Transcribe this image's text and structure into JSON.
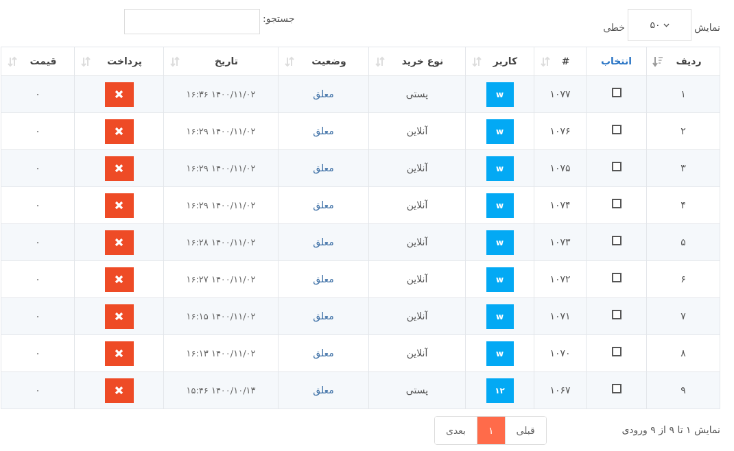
{
  "length_control": {
    "prefix": "نمایش",
    "value": "۵۰",
    "suffix": "خطی"
  },
  "search": {
    "label": "جستجو:"
  },
  "table": {
    "columns": [
      {
        "label": "ردیف",
        "sortable": true,
        "sorted": true,
        "link": false
      },
      {
        "label": "انتخاب",
        "sortable": false,
        "link": true
      },
      {
        "label": "#",
        "sortable": true,
        "sorted": false,
        "link": false
      },
      {
        "label": "کاربر",
        "sortable": true,
        "sorted": false,
        "link": false
      },
      {
        "label": "نوع خرید",
        "sortable": true,
        "sorted": false,
        "link": false
      },
      {
        "label": "وضعیت",
        "sortable": true,
        "sorted": false,
        "link": false
      },
      {
        "label": "تاریخ",
        "sortable": true,
        "sorted": false,
        "link": false
      },
      {
        "label": "پرداخت",
        "sortable": true,
        "sorted": false,
        "link": false
      },
      {
        "label": "قیمت",
        "sortable": true,
        "sorted": false,
        "link": false
      }
    ],
    "rows": [
      {
        "row": "۱",
        "checked": false,
        "id": "۱۰۷۷",
        "user": "w",
        "type": "پستی",
        "status": "معلق",
        "date": "۱۴۰۰/۱۱/۰۲ ۱۶:۳۶",
        "paid": false,
        "price": "۰"
      },
      {
        "row": "۲",
        "checked": false,
        "id": "۱۰۷۶",
        "user": "w",
        "type": "آنلاین",
        "status": "معلق",
        "date": "۱۴۰۰/۱۱/۰۲ ۱۶:۲۹",
        "paid": false,
        "price": "۰"
      },
      {
        "row": "۳",
        "checked": false,
        "id": "۱۰۷۵",
        "user": "w",
        "type": "آنلاین",
        "status": "معلق",
        "date": "۱۴۰۰/۱۱/۰۲ ۱۶:۲۹",
        "paid": false,
        "price": "۰"
      },
      {
        "row": "۴",
        "checked": false,
        "id": "۱۰۷۴",
        "user": "w",
        "type": "آنلاین",
        "status": "معلق",
        "date": "۱۴۰۰/۱۱/۰۲ ۱۶:۲۹",
        "paid": false,
        "price": "۰"
      },
      {
        "row": "۵",
        "checked": false,
        "id": "۱۰۷۳",
        "user": "w",
        "type": "آنلاین",
        "status": "معلق",
        "date": "۱۴۰۰/۱۱/۰۲ ۱۶:۲۸",
        "paid": false,
        "price": "۰"
      },
      {
        "row": "۶",
        "checked": false,
        "id": "۱۰۷۲",
        "user": "w",
        "type": "آنلاین",
        "status": "معلق",
        "date": "۱۴۰۰/۱۱/۰۲ ۱۶:۲۷",
        "paid": false,
        "price": "۰"
      },
      {
        "row": "۷",
        "checked": false,
        "id": "۱۰۷۱",
        "user": "w",
        "type": "آنلاین",
        "status": "معلق",
        "date": "۱۴۰۰/۱۱/۰۲ ۱۶:۱۵",
        "paid": false,
        "price": "۰"
      },
      {
        "row": "۸",
        "checked": false,
        "id": "۱۰۷۰",
        "user": "w",
        "type": "آنلاین",
        "status": "معلق",
        "date": "۱۴۰۰/۱۱/۰۲ ۱۶:۱۳",
        "paid": false,
        "price": "۰"
      },
      {
        "row": "۹",
        "checked": false,
        "id": "۱۰۶۷",
        "user": "۱۲",
        "type": "پستی",
        "status": "معلق",
        "date": "۱۴۰۰/۱۰/۱۳ ۱۵:۴۶",
        "paid": false,
        "price": "۰"
      }
    ]
  },
  "info": "نمایش ۱ تا ۹ از ۹ ورودی",
  "pagination": [
    {
      "label": "قبلی",
      "selected": false,
      "disabled": true
    },
    {
      "label": "۱",
      "selected": true,
      "disabled": false
    },
    {
      "label": "بعدی",
      "selected": false,
      "disabled": true
    }
  ]
}
